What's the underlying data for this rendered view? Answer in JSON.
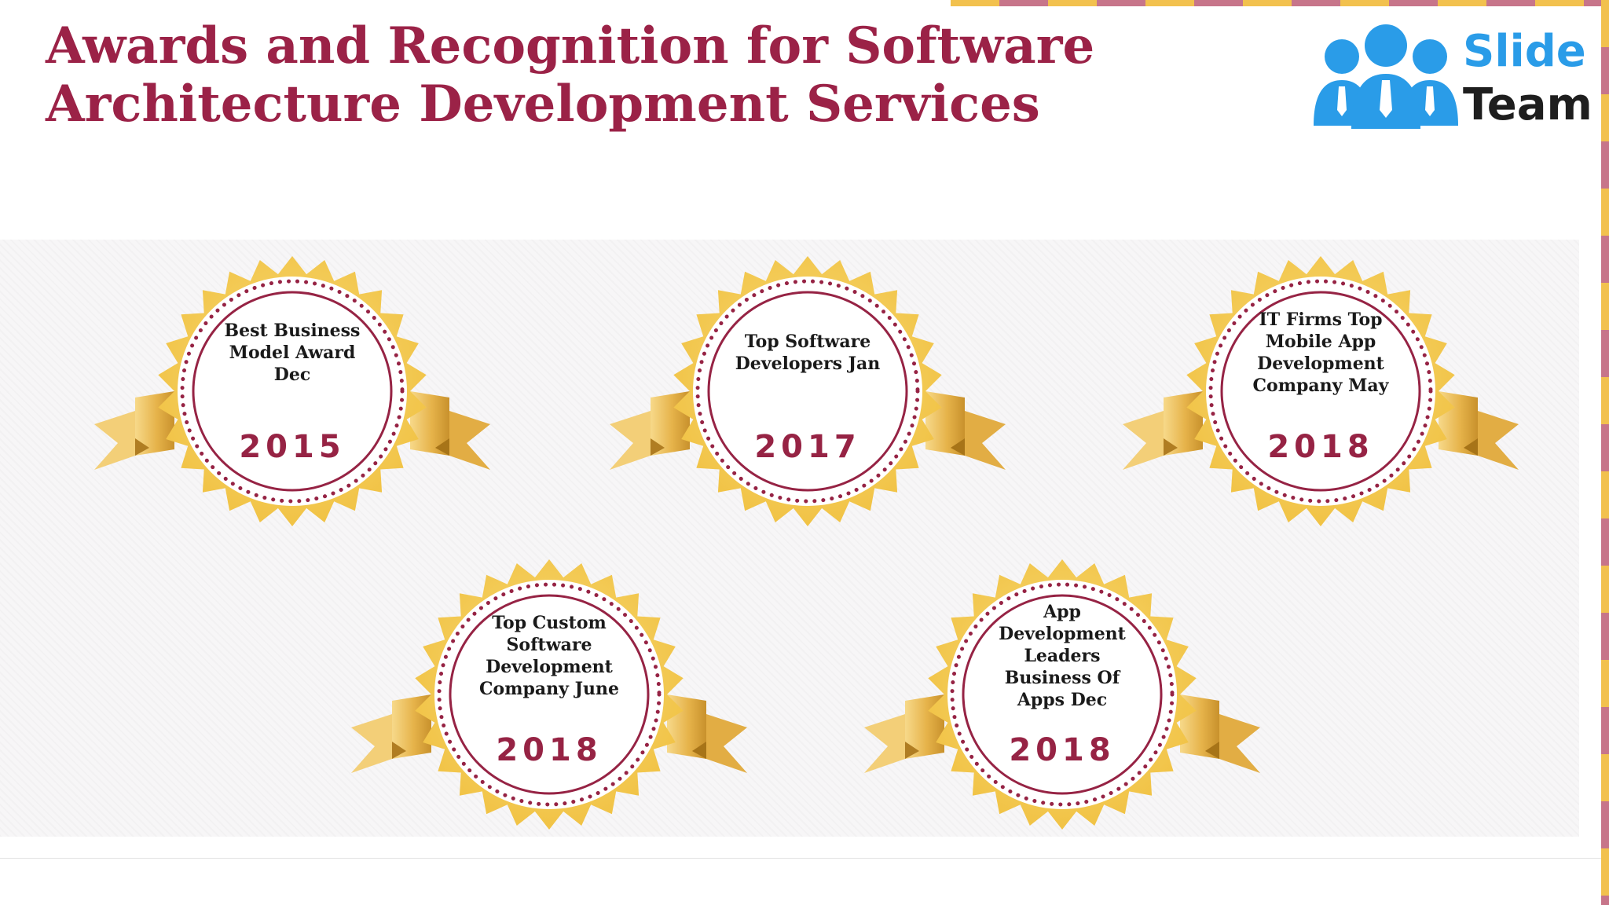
{
  "slide": {
    "title": "Awards and Recognition for Software Architecture Development Services"
  },
  "logo": {
    "word_top": "Slide",
    "word_bottom": "Team",
    "icon": "people-group-icon",
    "colors": {
      "blue": "#2a9ce8",
      "dark": "#1e1e1e"
    }
  },
  "colors": {
    "title": "#9b2247",
    "gold": "#f0c040",
    "gold_light": "#f9dd7c",
    "ring": "#962344",
    "stripe_gold": "#f2c14e",
    "stripe_pink": "#c7758a"
  },
  "awards": [
    {
      "text": "Best Business Model Award Dec",
      "year": "2015",
      "icon": "award-badge-icon"
    },
    {
      "text": "Top Software Developers Jan",
      "year": "2017",
      "icon": "award-badge-icon"
    },
    {
      "text": "IT Firms Top Mobile App Development Company May",
      "year": "2018",
      "icon": "award-badge-icon"
    },
    {
      "text": "Top Custom Software Development Company June",
      "year": "2018",
      "icon": "award-badge-icon"
    },
    {
      "text": "App Development Leaders Business Of Apps Dec",
      "year": "2018",
      "icon": "award-badge-icon"
    }
  ]
}
